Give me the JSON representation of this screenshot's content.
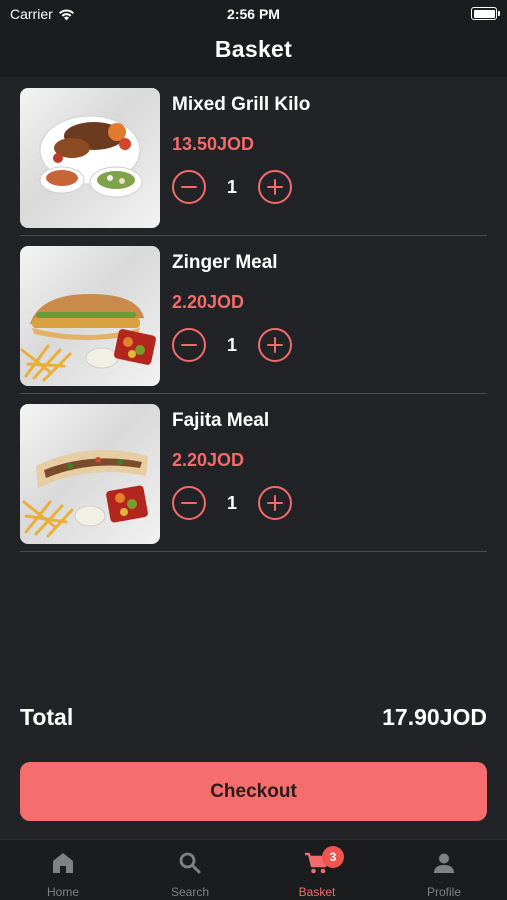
{
  "status_bar": {
    "carrier": "Carrier",
    "time": "2:56 PM"
  },
  "header": {
    "title": "Basket"
  },
  "basket": {
    "items": [
      {
        "name": "Mixed Grill Kilo",
        "price": "13.50JOD",
        "quantity": "1",
        "image": "mixed-grill-photo"
      },
      {
        "name": "Zinger Meal",
        "price": "2.20JOD",
        "quantity": "1",
        "image": "zinger-meal-photo"
      },
      {
        "name": "Fajita Meal",
        "price": "2.20JOD",
        "quantity": "1",
        "image": "fajita-meal-photo"
      }
    ],
    "total_label": "Total",
    "total_value": "17.90JOD",
    "checkout_label": "Checkout"
  },
  "tabbar": {
    "tabs": [
      {
        "label": "Home",
        "icon": "home-icon",
        "active": false
      },
      {
        "label": "Search",
        "icon": "search-icon",
        "active": false
      },
      {
        "label": "Basket",
        "icon": "cart-icon",
        "active": true,
        "badge": "3"
      },
      {
        "label": "Profile",
        "icon": "person-icon",
        "active": false
      }
    ]
  },
  "colors": {
    "background": "#222326",
    "bar_background": "#1b1c1e",
    "accent": "#f36b6b",
    "checkout_button": "#f56d6c",
    "badge": "#f0544f",
    "inactive_tab": "#808185"
  }
}
